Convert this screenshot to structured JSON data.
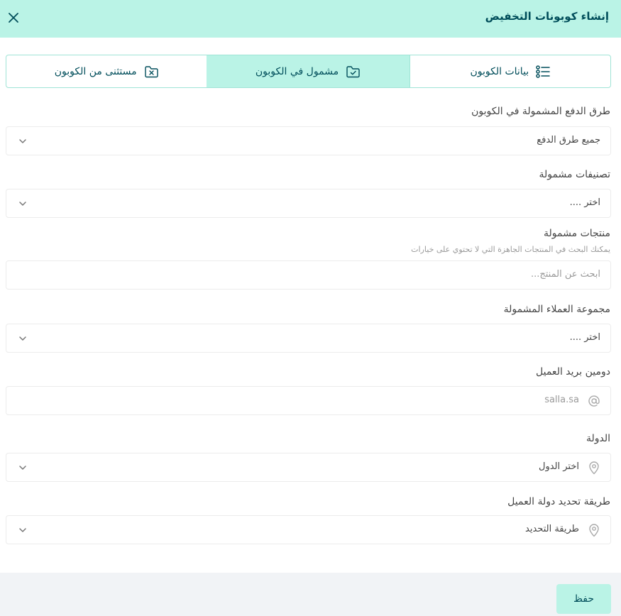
{
  "dialog": {
    "title": "إنشاء كوبونات التخفيض"
  },
  "tabs": [
    {
      "label": "بيانات الكوبون",
      "icon": "list-icon",
      "active": false
    },
    {
      "label": "مشمول في الكوبون",
      "icon": "folder-check-icon",
      "active": true
    },
    {
      "label": "مستثنى من الكوبون",
      "icon": "folder-x-icon",
      "active": false
    }
  ],
  "form": {
    "payment_methods": {
      "label": "طرق الدفع المشمولة في الكوبون",
      "value": "جميع طرق الدفع"
    },
    "categories": {
      "label": "تصنيفات مشمولة",
      "value": "اختر ...."
    },
    "products": {
      "label": "منتجات مشمولة",
      "hint": "يمكنك البحث في المنتجات الجاهزة التي لا تحتوي على خيارات",
      "placeholder": "ابحث عن المنتج..."
    },
    "customer_groups": {
      "label": "مجموعة العملاء المشمولة",
      "value": "اختر ...."
    },
    "email_domain": {
      "label": "دومين بريد العميل",
      "placeholder": "salla.sa"
    },
    "country": {
      "label": "الدولة",
      "value": "اختر الدول"
    },
    "country_method": {
      "label": "طريقة تحديد دولة العميل",
      "value": "طريقة التحديد"
    }
  },
  "footer": {
    "save_label": "حفظ"
  },
  "colors": {
    "accent_bg": "#baf3e6",
    "accent_text": "#004d5a",
    "footer_bg": "#f1f3f6"
  }
}
